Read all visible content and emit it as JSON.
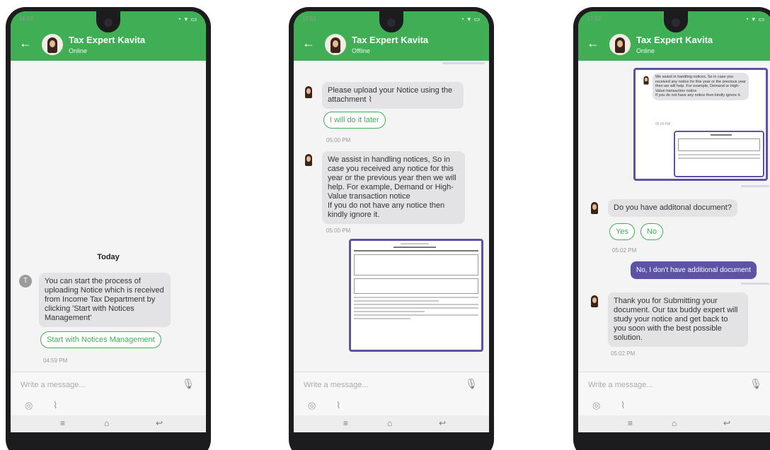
{
  "contact": {
    "name": "Tax Expert Kavita"
  },
  "composer": {
    "placeholder": "Write a message..."
  },
  "phones": [
    {
      "time": "16:59",
      "status": "Online",
      "date_label": "Today",
      "avatar_letter": "T",
      "message": "You can start the process of uploading Notice which is received from Income Tax Department by clicking 'Start with Notices Management'",
      "button": "Start with Notices Management",
      "timestamp": "04:59 PM"
    },
    {
      "time": "17:01",
      "status": "Offline",
      "message1": "Please upload your Notice using the attachment",
      "button1": "I will do it later",
      "timestamp1": "05:00 PM",
      "message2": "We assist in handling notices, So in case you received any notice for this year or the previous year then we will help. For example, Demand or High-Value transaction notice\nIf you do not have any notice then kindly ignore it.",
      "timestamp2": "05:00 PM"
    },
    {
      "time": "17:02",
      "status": "Online",
      "quoted_message": "We assist in handling notices, So in case you received any notice for this year or the previous year then we will help. For example, Demand or High-Value transaction notice\nIf you do not have any notice then kindly ignore it.",
      "quoted_timestamp": "05:00 PM",
      "question": "Do you have additonal document?",
      "yes": "Yes",
      "no": "No",
      "timestamp1": "05:02 PM",
      "reply": "No, I don't have additional document",
      "final_message": "Thank you for Submitting your document. Our tax buddy expert will study your notice and get back to you soon with the best possible solution.",
      "timestamp2": "05:02 PM"
    }
  ],
  "icons": {
    "back": "back-arrow-icon",
    "mic": "microphone-icon",
    "camera": "camera-icon",
    "attach": "paperclip-icon",
    "nav_menu": "menu-icon",
    "nav_home": "home-icon",
    "nav_back": "back-icon"
  },
  "colors": {
    "header": "#3fae55",
    "outgoing": "#5c53a6",
    "incoming": "#e3e3e6"
  }
}
